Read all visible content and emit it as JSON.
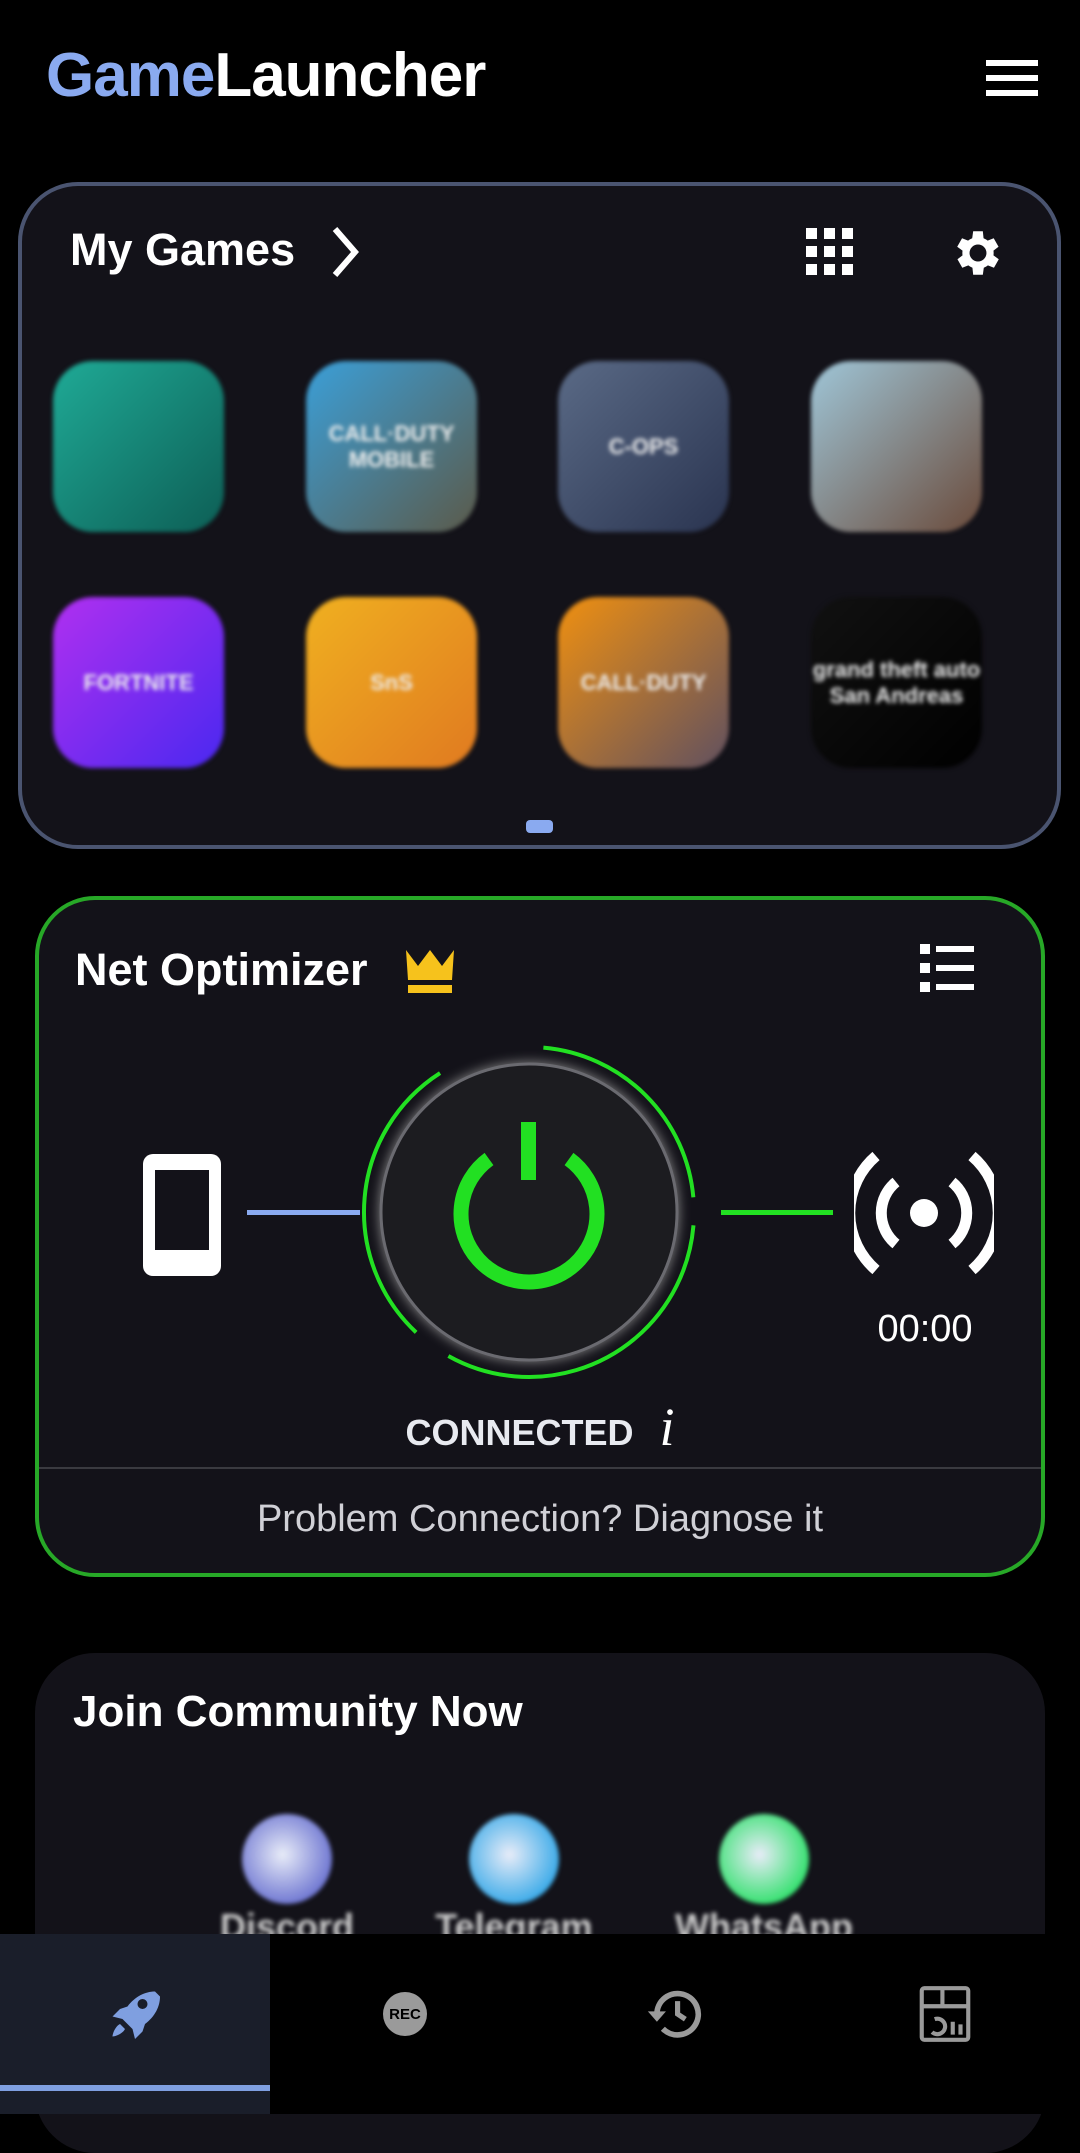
{
  "header": {
    "brand_part1": "Game",
    "brand_part2": "Launcher",
    "menu_icon": "hamburger-icon"
  },
  "my_games": {
    "title": "My Games",
    "icons": [
      "chevron-right-icon",
      "grid-icon",
      "gear-icon"
    ],
    "games": [
      {
        "logo": "",
        "colors": [
          "#1faa96",
          "#0d5e55"
        ]
      },
      {
        "logo": "CALL·DUTY MOBILE",
        "colors": [
          "#3b9fd8",
          "#5b5a4a"
        ]
      },
      {
        "logo": "C-OPS",
        "colors": [
          "#5a6a86",
          "#2a3450"
        ]
      },
      {
        "logo": "",
        "colors": [
          "#9fc6d8",
          "#6a4a3a"
        ]
      },
      {
        "logo": "FORTNITE",
        "colors": [
          "#b030f0",
          "#4a28f0"
        ]
      },
      {
        "logo": "SnS",
        "colors": [
          "#f0b020",
          "#e07a20"
        ]
      },
      {
        "logo": "CALL·DUTY",
        "colors": [
          "#f09010",
          "#605060"
        ]
      },
      {
        "logo": "grand theft auto San Andreas",
        "colors": [
          "#111111",
          "#000000"
        ]
      }
    ],
    "page_indicator": {
      "current": 1,
      "total": 1
    }
  },
  "net_optimizer": {
    "title": "Net Optimizer",
    "premium_icon": "crown-icon",
    "list_icon": "list-icon",
    "timer": "00:00",
    "status": "CONNECTED",
    "info_label": "i",
    "diagnose_label": "Problem Connection? Diagnose it",
    "colors": {
      "connected": "#22e022",
      "device_link": "#8aaaf0",
      "crown": "#f6c21c"
    }
  },
  "community": {
    "title": "Join Community Now",
    "items": [
      {
        "label": "Discord",
        "color": "#6a72d0"
      },
      {
        "label": "Telegram",
        "color": "#35a8e8"
      },
      {
        "label": "WhatsApp",
        "color": "#2ee06a"
      }
    ]
  },
  "bottom_nav": {
    "tabs": [
      {
        "icon": "rocket-icon",
        "active": true
      },
      {
        "icon": "rec-icon",
        "label": "REC",
        "active": false
      },
      {
        "icon": "history-icon",
        "active": false
      },
      {
        "icon": "dashboard-icon",
        "active": false
      }
    ],
    "accent": "#7f9fe0"
  }
}
